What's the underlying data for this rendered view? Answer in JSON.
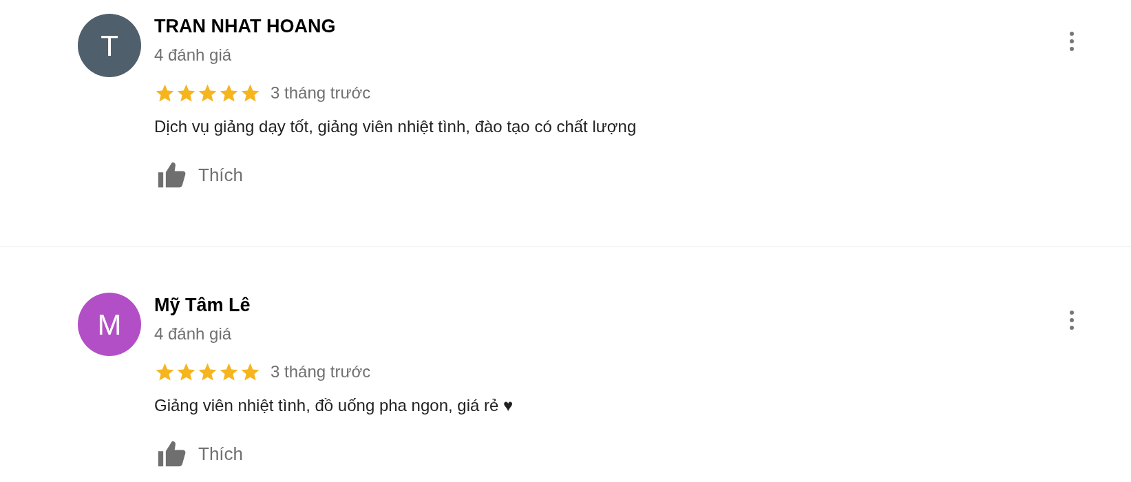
{
  "reviews": [
    {
      "initial": "T",
      "color": "#4f5f6c",
      "name": "TRAN NHAT HOANG",
      "review_count": "4 đánh giá",
      "stars": 5,
      "time": "3 tháng trước",
      "text": "Dịch vụ giảng dạy tốt, giảng viên nhiệt tình, đào tạo có chất lượng",
      "like_label": "Thích"
    },
    {
      "initial": "M",
      "color": "#b34fc6",
      "name": "Mỹ Tâm Lê",
      "review_count": "4 đánh giá",
      "stars": 5,
      "time": "3 tháng trước",
      "text": "Giảng viên nhiệt tình, đồ uống pha ngon, giá rẻ ♥",
      "like_label": "Thích"
    }
  ]
}
